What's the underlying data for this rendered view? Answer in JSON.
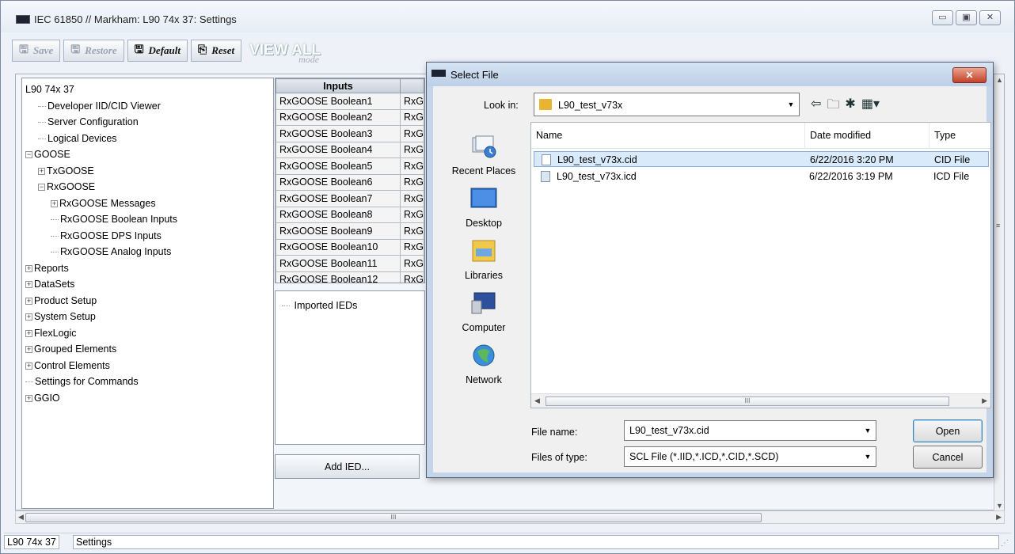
{
  "window": {
    "title": "IEC 61850 // Markham: L90 74x 37: Settings",
    "caption_buttons": [
      "▭",
      "▣",
      "✕"
    ]
  },
  "toolbar": {
    "save_label": "Save",
    "restore_label": "Restore",
    "default_label": "Default",
    "reset_label": "Reset",
    "view_all_label": "VIEW ALL",
    "view_all_mode": "mode"
  },
  "tree": {
    "items": [
      {
        "label": "L90 74x 37",
        "toggle": "",
        "indent": 0
      },
      {
        "label": "Developer IID/CID Viewer",
        "toggle": "dash",
        "indent": 1
      },
      {
        "label": "Server Configuration",
        "toggle": "dash",
        "indent": 1
      },
      {
        "label": "Logical Devices",
        "toggle": "dash",
        "indent": 1
      },
      {
        "label": "GOOSE",
        "toggle": "−",
        "indent": 0
      },
      {
        "label": "TxGOOSE",
        "toggle": "+",
        "indent": 1
      },
      {
        "label": "RxGOOSE",
        "toggle": "−",
        "indent": 1
      },
      {
        "label": "RxGOOSE Messages",
        "toggle": "+",
        "indent": 2
      },
      {
        "label": "RxGOOSE Boolean Inputs",
        "toggle": "dash",
        "indent": 2
      },
      {
        "label": "RxGOOSE DPS Inputs",
        "toggle": "dash",
        "indent": 2
      },
      {
        "label": "RxGOOSE Analog Inputs",
        "toggle": "dash",
        "indent": 2
      },
      {
        "label": "Reports",
        "toggle": "+",
        "indent": 0
      },
      {
        "label": "DataSets",
        "toggle": "+",
        "indent": 0
      },
      {
        "label": "Product Setup",
        "toggle": "+",
        "indent": 0
      },
      {
        "label": "System Setup",
        "toggle": "+",
        "indent": 0
      },
      {
        "label": "FlexLogic",
        "toggle": "+",
        "indent": 0
      },
      {
        "label": "Grouped Elements",
        "toggle": "+",
        "indent": 0
      },
      {
        "label": "Control Elements",
        "toggle": "+",
        "indent": 0
      },
      {
        "label": "Settings for Commands",
        "toggle": "dash",
        "indent": 0
      },
      {
        "label": "GGIO",
        "toggle": "+",
        "indent": 0
      }
    ]
  },
  "inputs_table": {
    "header": "Inputs",
    "rows": [
      [
        "RxGOOSE Boolean1",
        "RxG"
      ],
      [
        "RxGOOSE Boolean2",
        "RxG"
      ],
      [
        "RxGOOSE Boolean3",
        "RxG"
      ],
      [
        "RxGOOSE Boolean4",
        "RxG"
      ],
      [
        "RxGOOSE Boolean5",
        "RxG"
      ],
      [
        "RxGOOSE Boolean6",
        "RxG"
      ],
      [
        "RxGOOSE Boolean7",
        "RxG"
      ],
      [
        "RxGOOSE Boolean8",
        "RxG"
      ],
      [
        "RxGOOSE Boolean9",
        "RxG"
      ],
      [
        "RxGOOSE Boolean10",
        "RxG"
      ],
      [
        "RxGOOSE Boolean11",
        "RxG"
      ],
      [
        "RxGOOSE Boolean12",
        "RxG"
      ]
    ]
  },
  "ied_panel": {
    "root_label": "Imported IEDs",
    "add_button": "Add IED..."
  },
  "statusbar": {
    "device": "L90 74x 37",
    "mode": "Settings"
  },
  "dialog": {
    "title": "Select File",
    "close_label": "✕",
    "look_in_label": "Look in:",
    "look_in_value": "L90_test_v73x",
    "nav_icons": [
      "⇦",
      "🗀",
      "✱",
      "▦▾"
    ],
    "places": [
      "Recent Places",
      "Desktop",
      "Libraries",
      "Computer",
      "Network"
    ],
    "columns": {
      "name": "Name",
      "date": "Date modified",
      "type": "Type"
    },
    "files": [
      {
        "name": "L90_test_v73x.cid",
        "date": "6/22/2016 3:20 PM",
        "type": "CID File",
        "selected": true
      },
      {
        "name": "L90_test_v73x.icd",
        "date": "6/22/2016 3:19 PM",
        "type": "ICD File",
        "selected": false
      }
    ],
    "file_name_label": "File name:",
    "file_name_value": "L90_test_v73x.cid",
    "files_of_type_label": "Files of type:",
    "files_of_type_value": "SCL File (*.IID,*.ICD,*.CID,*.SCD)",
    "open_label": "Open",
    "cancel_label": "Cancel",
    "scroll_grip": "III"
  },
  "main_scroll_grip": "III"
}
